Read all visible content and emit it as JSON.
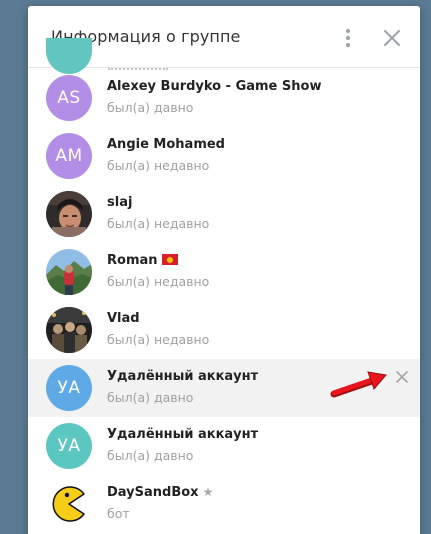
{
  "dialog": {
    "title": "Информация о группе"
  },
  "colors": {
    "accent_purple": "#b28ee6",
    "accent_teal": "#5cc6c1",
    "accent_blue": "#5fa9e6",
    "hover_row": "#f2f2f2",
    "arrow_red": "#e8161c"
  },
  "members": [
    {
      "name": "Alexey Burdyko - Game Show",
      "status": "был(а) давно",
      "initials": "AS",
      "avatar_color": "#b28ee6",
      "icon": "initials-avatar"
    },
    {
      "name": "Angie Mohamed",
      "status": "был(а) недавно",
      "initials": "AM",
      "avatar_color": "#b28ee6",
      "icon": "initials-avatar"
    },
    {
      "name": "slaj",
      "status": "был(а) недавно",
      "icon": "photo-avatar"
    },
    {
      "name": "Roman",
      "status": "был(а) недавно",
      "icon": "photo-avatar",
      "flag": "kyrgyzstan-flag-icon"
    },
    {
      "name": "Vlad",
      "status": "был(а) недавно",
      "icon": "photo-avatar"
    },
    {
      "name": "Удалённый аккаунт",
      "status": "был(а) давно",
      "initials": "УА",
      "avatar_color": "#5fa9e6",
      "icon": "initials-avatar",
      "hovered": true
    },
    {
      "name": "Удалённый аккаунт",
      "status": "был(а) давно",
      "initials": "УА",
      "avatar_color": "#5cc6c1",
      "icon": "initials-avatar"
    },
    {
      "name": "DaySandBox",
      "status": "бот",
      "icon": "pacman-avatar",
      "badge": "star-icon"
    }
  ]
}
